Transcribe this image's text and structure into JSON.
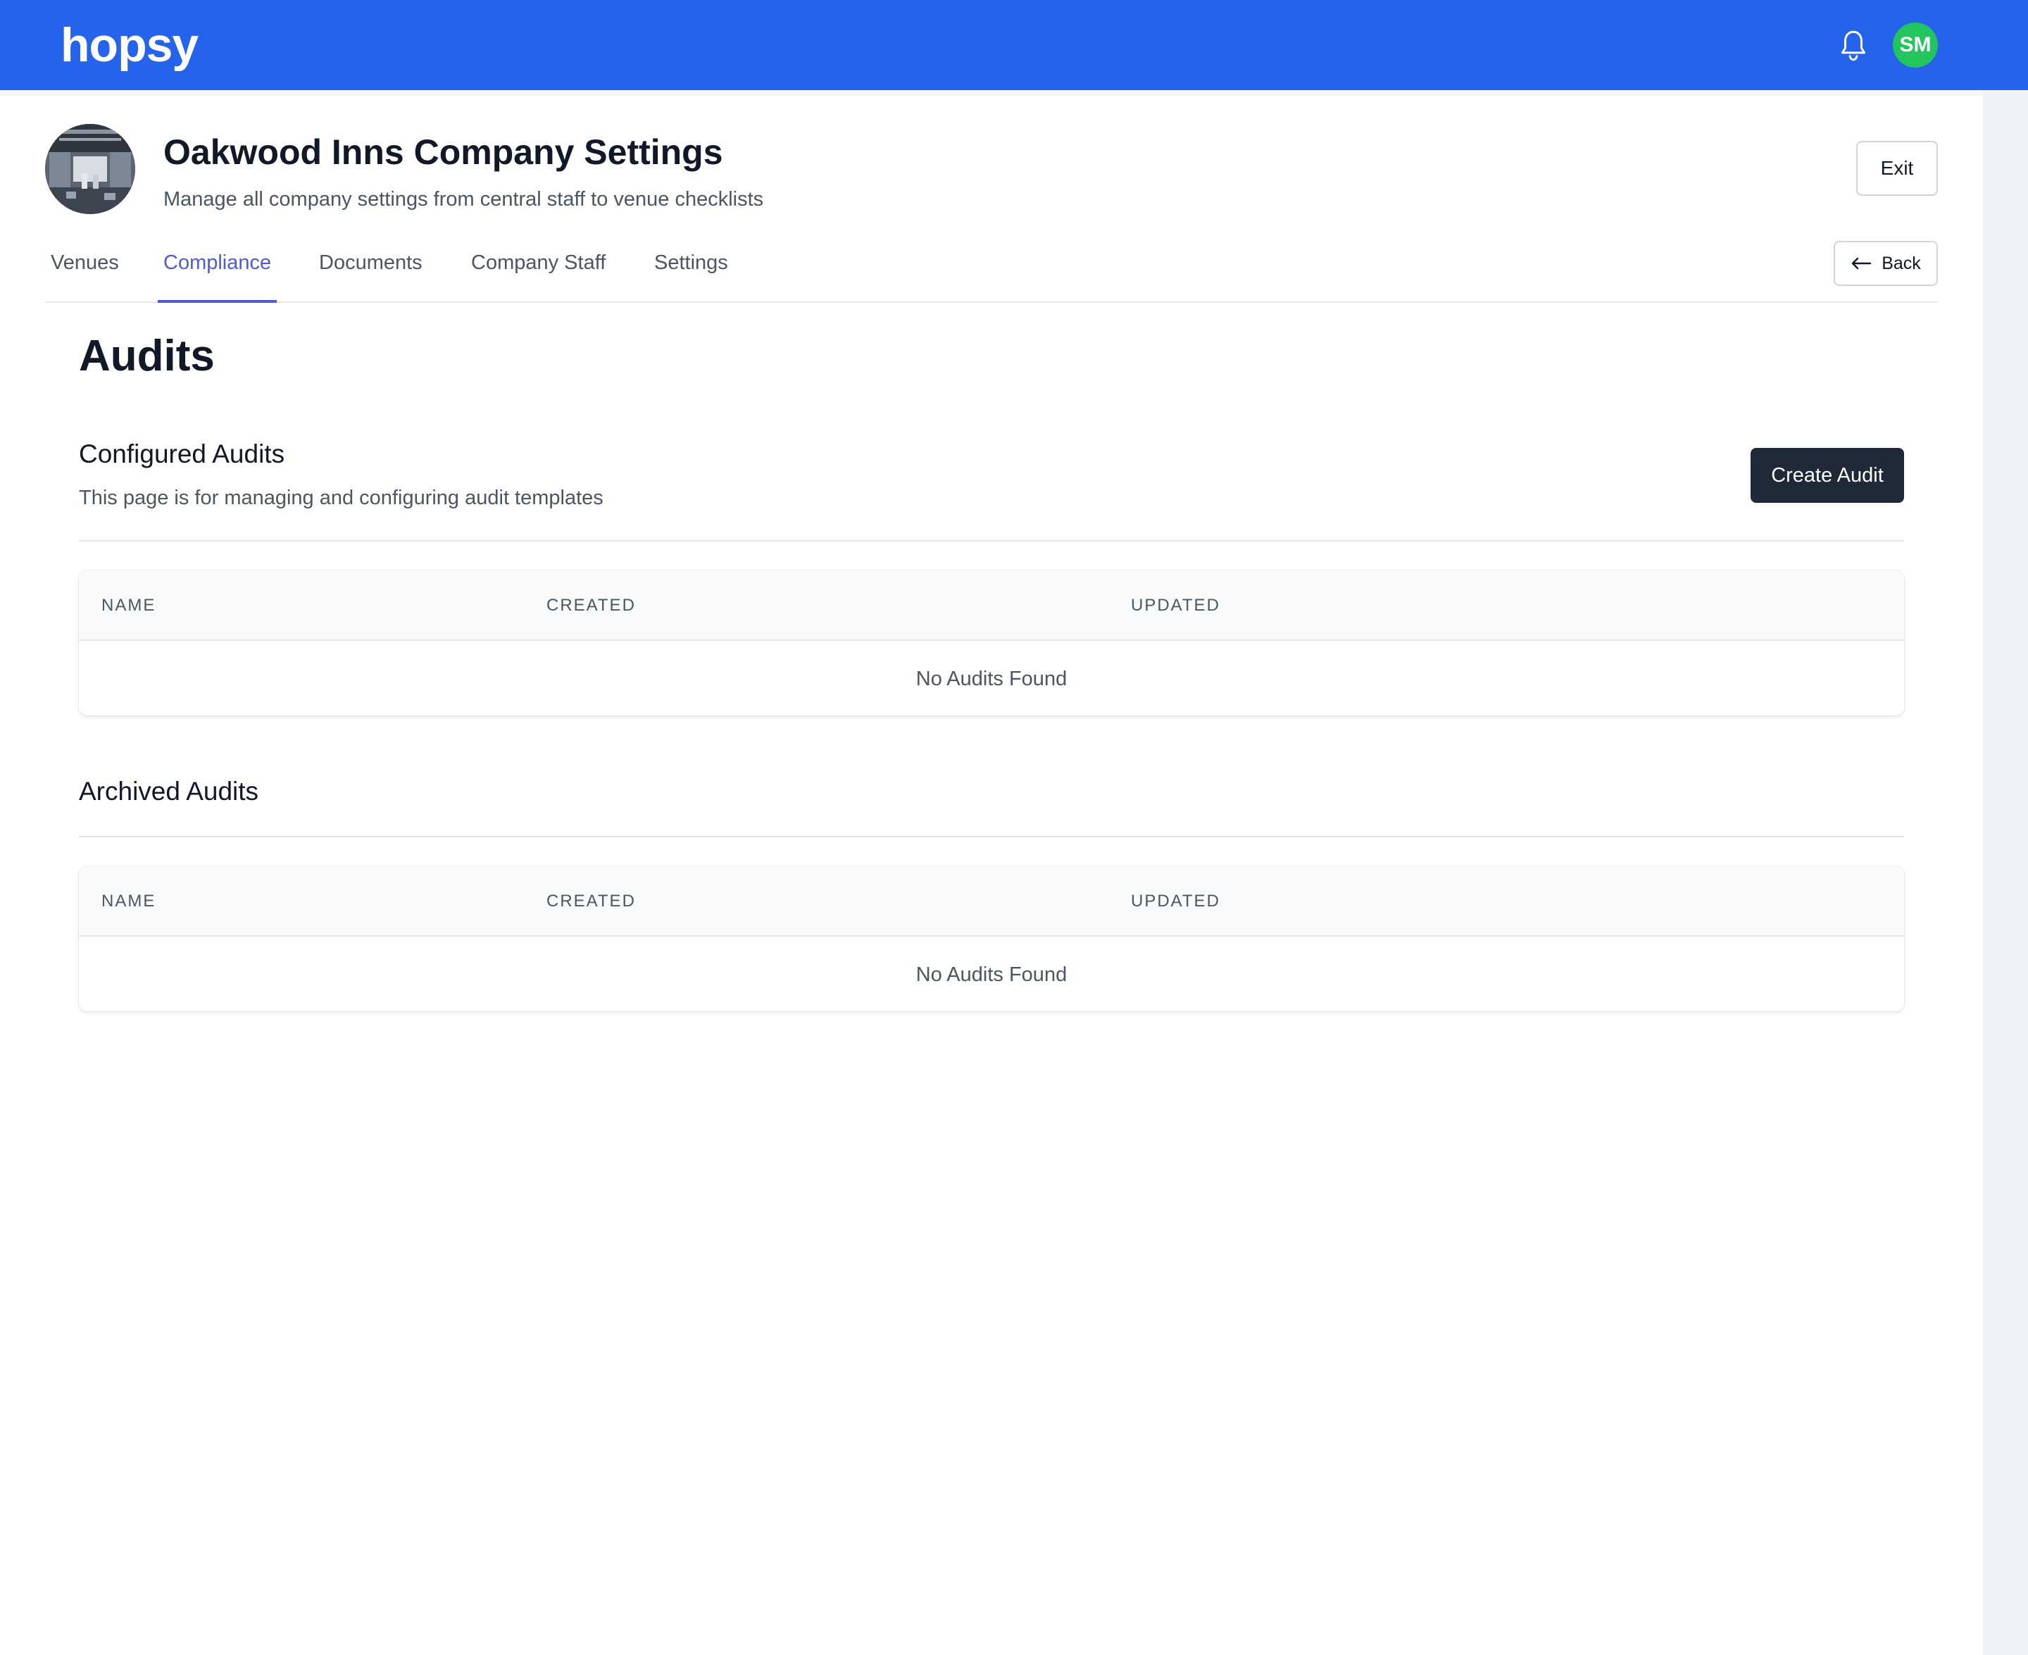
{
  "topbar": {
    "logo": "hopsy",
    "user_initials": "SM",
    "brand_color": "#2563eb",
    "avatar_color": "#22c55e",
    "notification_icon": "bell-icon"
  },
  "header": {
    "title": "Oakwood Inns Company Settings",
    "subtitle": "Manage all company settings from central staff to venue checklists",
    "exit_label": "Exit"
  },
  "tabs": [
    {
      "label": "Venues",
      "active": false
    },
    {
      "label": "Compliance",
      "active": true
    },
    {
      "label": "Documents",
      "active": false
    },
    {
      "label": "Company Staff",
      "active": false
    },
    {
      "label": "Settings",
      "active": false
    }
  ],
  "back_label": "Back",
  "main": {
    "heading": "Audits",
    "configured": {
      "title": "Configured Audits",
      "description": "This page is for managing and configuring audit templates",
      "create_label": "Create Audit",
      "columns": [
        "NAME",
        "CREATED",
        "UPDATED"
      ],
      "empty_text": "No Audits Found"
    },
    "archived": {
      "title": "Archived Audits",
      "columns": [
        "NAME",
        "CREATED",
        "UPDATED"
      ],
      "empty_text": "No Audits Found"
    }
  }
}
